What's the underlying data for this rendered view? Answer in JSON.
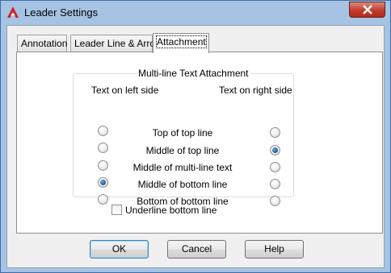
{
  "window": {
    "title": "Leader Settings"
  },
  "tabs": [
    {
      "label": "Annotation",
      "selected": false
    },
    {
      "label": "Leader Line & Arrow",
      "selected": false
    },
    {
      "label": "Attachment",
      "selected": true
    }
  ],
  "attachment": {
    "group_title": "Multi-line Text Attachment",
    "left_header": "Text on left side",
    "right_header": "Text on right side",
    "options": [
      {
        "label": "Top of top line",
        "left_checked": false,
        "right_checked": false
      },
      {
        "label": "Middle of top line",
        "left_checked": false,
        "right_checked": true
      },
      {
        "label": "Middle of multi-line text",
        "left_checked": false,
        "right_checked": false
      },
      {
        "label": "Middle of bottom line",
        "left_checked": true,
        "right_checked": false
      },
      {
        "label": "Bottom of bottom line",
        "left_checked": false,
        "right_checked": false
      }
    ],
    "underline_checkbox": {
      "label": "Underline bottom line",
      "checked": false
    }
  },
  "buttons": {
    "ok": "OK",
    "cancel": "Cancel",
    "help": "Help"
  },
  "icons": {
    "app": "autocad-logo-icon",
    "close": "close-icon"
  },
  "colors": {
    "title_bar": "#a7c3e4",
    "close_button": "#c33c2c",
    "radio_checked": "#1c4f8f"
  }
}
